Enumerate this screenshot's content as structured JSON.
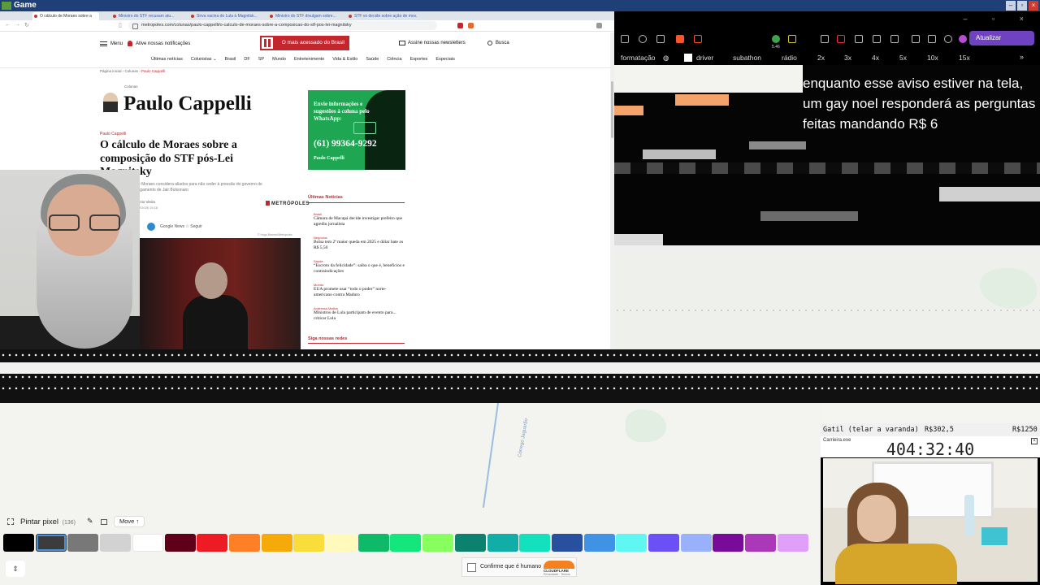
{
  "titlebar": {
    "title": "Game"
  },
  "left_browser": {
    "tabs": [
      "O cálculo de Moraes sobre a",
      "Ministro do STF recusam atu...",
      "Sirva vacina do Lula à Magnitsk...",
      "Ministro do STF divulgam sobre...",
      "STF vo decide sobre ação de mov..."
    ],
    "url": "metropoles.com/colunas/paulo-cappelli/o-calculo-de-moraes-sobre-a-composicao-do-stf-pos-lei-magnitsky",
    "header": {
      "menu": "Menu",
      "notifications": "Ative nossas notificações",
      "most_accessed": "O mais acessado do Brasil",
      "newsletter": "Assine nossas newsletters",
      "search": "Busca"
    },
    "nav": [
      "Últimas notícias",
      "Colunistas ⌄",
      "Brasil",
      "DF",
      "SP",
      "Mundo",
      "Entretenimento",
      "Vida & Estilo",
      "Saúde",
      "Ciência",
      "Esportes",
      "Especiais"
    ],
    "breadcrumb": [
      "Página inicial",
      "Colunas",
      "Paulo Cappelli"
    ],
    "kicker": "Colunas",
    "columnist": "Paulo Cappelli",
    "section": "Paulo Cappelli",
    "headline": "O cálculo de Moraes sobre a composição do STF pós-Lei Magnitsky",
    "lead": "...de Moraes considera aliados para não ceder à pressão do governo de ...julgamento de Jair Bolsonaro",
    "author": "Antônio Vieira",
    "date": "10/02/2026 15:18",
    "logo": "METRÓPOLES",
    "google_news": "Google News",
    "follow": "☆ Seguir",
    "photo_credit": "© Hugo Barreto/Metrópoles",
    "ad": {
      "text": "Envie informações e sugestões à coluna pelo WhatsApp:",
      "phone": "(61) 99364-9292",
      "signature": "Paulo Cappelli"
    },
    "latest": {
      "title": "Últimas Notícias",
      "items": [
        {
          "category": "Brasil",
          "headline": "Câmara de Macapá decide investigar prefeito que agrediu jornalista"
        },
        {
          "category": "Negócios",
          "headline": "Bolsa tem 2ª maior queda em 2025 e dólar bate os R$ 5,50"
        },
        {
          "category": "Saúde",
          "headline": "“Escroto da felicidade”: saiba o que é, benefícios e contraindicações"
        },
        {
          "category": "Mundo",
          "headline": "EUA promete usar “todo o poder” norte-americano contra Maduro"
        },
        {
          "category": "Andressa Mattos",
          "headline": "Ministros de Lula participam de evento para... criticar Lula"
        }
      ],
      "social": "Siga nossas redes"
    }
  },
  "right_browser": {
    "update_button": "Atualizar",
    "badge": "5.46",
    "bookmarks": [
      "formatação",
      "driver",
      "subathon",
      "rádio",
      "2x",
      "3x",
      "4x",
      "5x",
      "10x",
      "15x"
    ],
    "more": "»",
    "overlay_text": "enquanto esse aviso estiver na tela, um gay noel responderá as perguntas feitas mandando R$ 6"
  },
  "map": {
    "road_label": "Córrego Jaguarão"
  },
  "game_toolbar": {
    "paint_label": "Pintar pixel",
    "paint_count": "(136)",
    "move": "Move ↑",
    "chevron": "⇕"
  },
  "palette": {
    "colors": [
      "#000000",
      "#3c3c3c",
      "#787878",
      "#d2d2d2",
      "#ffffff",
      "#600018",
      "#ed1c24",
      "#ff7f27",
      "#f6aa09",
      "#f9dd3b",
      "#fffabc",
      "#0eb968",
      "#13e67b",
      "#87ff5e",
      "#0c816e",
      "#10aea6",
      "#13e1be",
      "#28509e",
      "#4093e4",
      "#60f7f2",
      "#6b50f6",
      "#99b1fb",
      "#780c99",
      "#aa38b9",
      "#e09ff9"
    ],
    "selected_index": 1
  },
  "captcha": {
    "label": "Confirme que é humano",
    "brand": "CLOUDFLARE",
    "links": "Privacidade · Termos"
  },
  "webcam_right": {
    "goal_left": "Gatil (telar a varanda)",
    "goal_mid": "R$302,5",
    "goal_right": "R$1250",
    "timer_window": "Carrieira.exe",
    "timer": "404:32:40"
  }
}
